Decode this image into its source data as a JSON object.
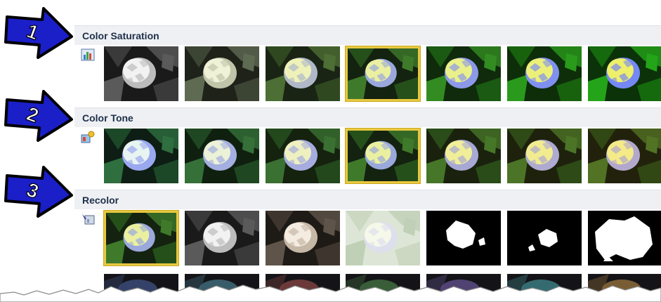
{
  "sections": [
    {
      "title": "Color Saturation",
      "icon": "saturation-icon",
      "selected_index": 3
    },
    {
      "title": "Color Tone",
      "icon": "color-tone-icon",
      "selected_index": 3
    },
    {
      "title": "Recolor",
      "icon": "recolor-icon",
      "selected_index": 0
    }
  ],
  "callouts": [
    "1",
    "2",
    "3"
  ],
  "colors": {
    "accent_border": "#e8c840",
    "header_bg": "#eef0f4",
    "header_text": "#1e2f48",
    "arrow_fill": "#1a1fc8"
  }
}
